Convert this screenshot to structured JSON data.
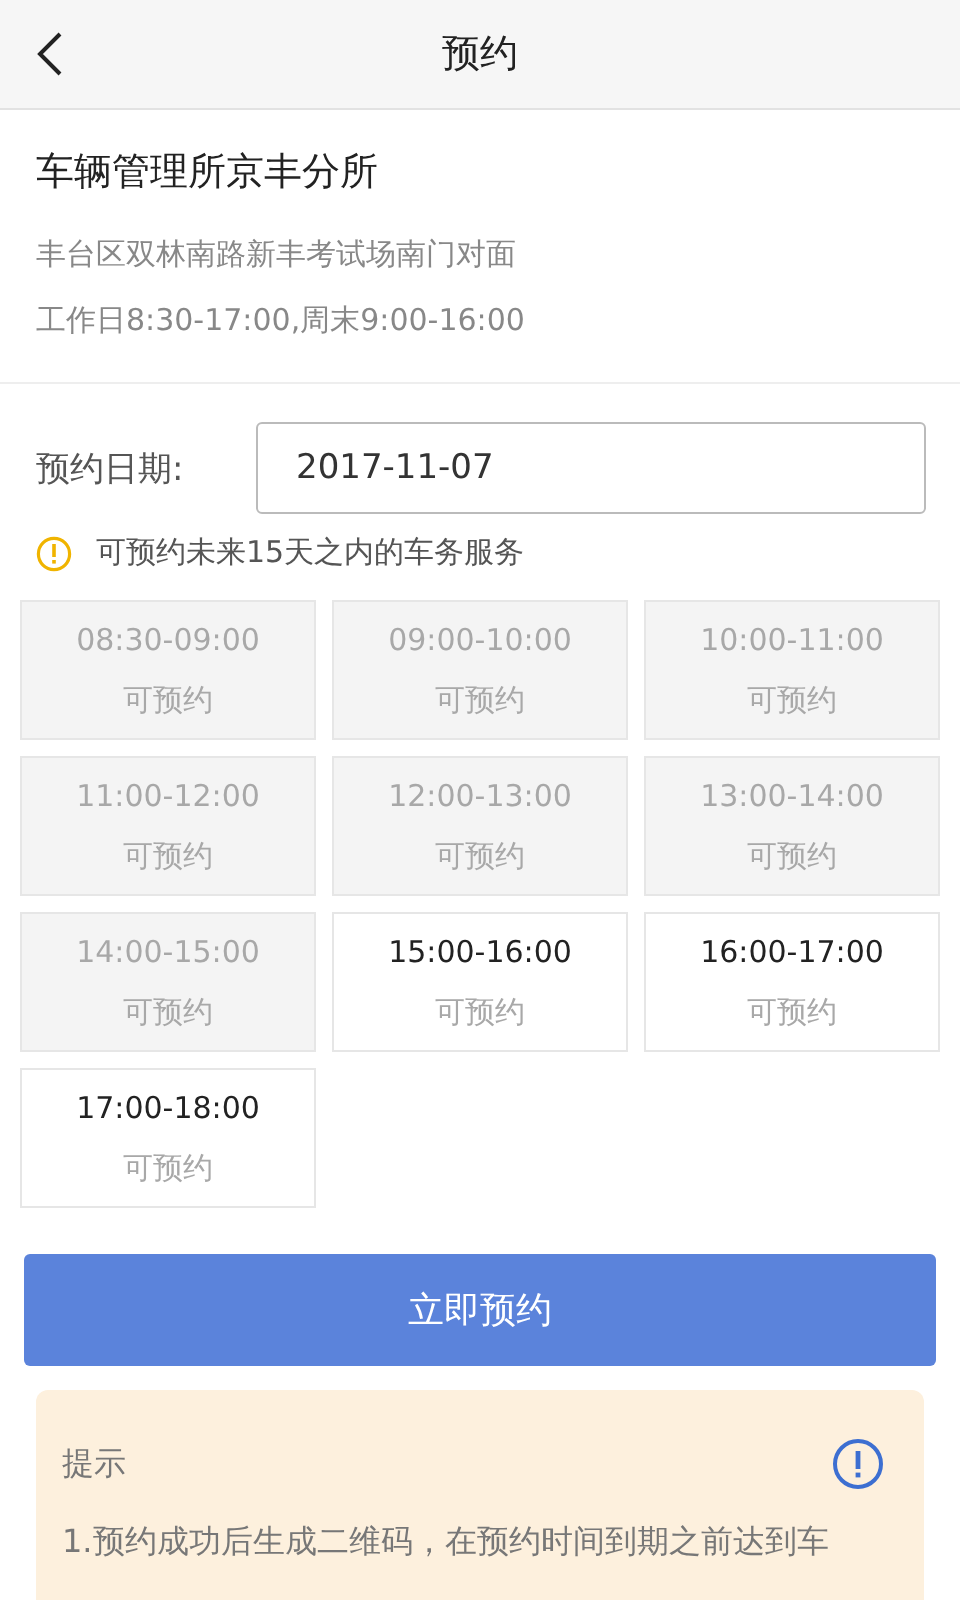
{
  "header": {
    "title": "预约"
  },
  "office": {
    "name": "车辆管理所京丰分所",
    "address": "丰台区双林南路新丰考试场南门对面",
    "hours": "工作日8:30-17:00,周末9:00-16:00"
  },
  "date_field": {
    "label": "预约日期:",
    "value": "2017-11-07"
  },
  "notice": "可预约未来15天之内的车务服务",
  "slots": [
    {
      "time": "08:30-09:00",
      "status": "可预约",
      "disabled": true
    },
    {
      "time": "09:00-10:00",
      "status": "可预约",
      "disabled": true
    },
    {
      "time": "10:00-11:00",
      "status": "可预约",
      "disabled": true
    },
    {
      "time": "11:00-12:00",
      "status": "可预约",
      "disabled": true
    },
    {
      "time": "12:00-13:00",
      "status": "可预约",
      "disabled": true
    },
    {
      "time": "13:00-14:00",
      "status": "可预约",
      "disabled": true
    },
    {
      "time": "14:00-15:00",
      "status": "可预约",
      "disabled": true
    },
    {
      "time": "15:00-16:00",
      "status": "可预约",
      "disabled": false
    },
    {
      "time": "16:00-17:00",
      "status": "可预约",
      "disabled": false
    },
    {
      "time": "17:00-18:00",
      "status": "可预约",
      "disabled": false
    }
  ],
  "submit_button": "立即预约",
  "tip": {
    "title": "提示",
    "text": "1.预约成功后生成二维码，在预约时间到期之前达到车"
  }
}
